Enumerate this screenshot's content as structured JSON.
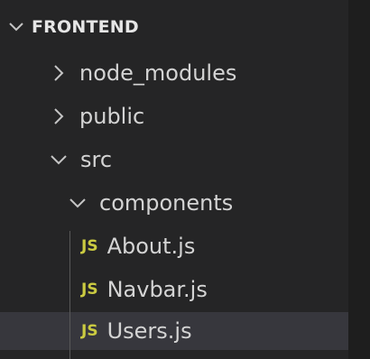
{
  "explorer": {
    "section_title": "FRONTEND",
    "colors": {
      "background": "#252526",
      "selected_row": "#37373d",
      "text": "#d4d4d4",
      "js_badge": "#cbcb41"
    },
    "items": [
      {
        "label": "node_modules",
        "kind": "folder",
        "expanded": false,
        "icon": "chevron-right-icon"
      },
      {
        "label": "public",
        "kind": "folder",
        "expanded": false,
        "icon": "chevron-right-icon"
      },
      {
        "label": "src",
        "kind": "folder",
        "expanded": true,
        "icon": "chevron-down-icon"
      },
      {
        "label": "components",
        "kind": "folder",
        "expanded": true,
        "icon": "chevron-down-icon"
      },
      {
        "label": "About.js",
        "kind": "file",
        "badge": "JS",
        "icon": "javascript-file-icon"
      },
      {
        "label": "Navbar.js",
        "kind": "file",
        "badge": "JS",
        "icon": "javascript-file-icon"
      },
      {
        "label": "Users.js",
        "kind": "file",
        "badge": "JS",
        "icon": "javascript-file-icon",
        "selected": true
      }
    ]
  }
}
